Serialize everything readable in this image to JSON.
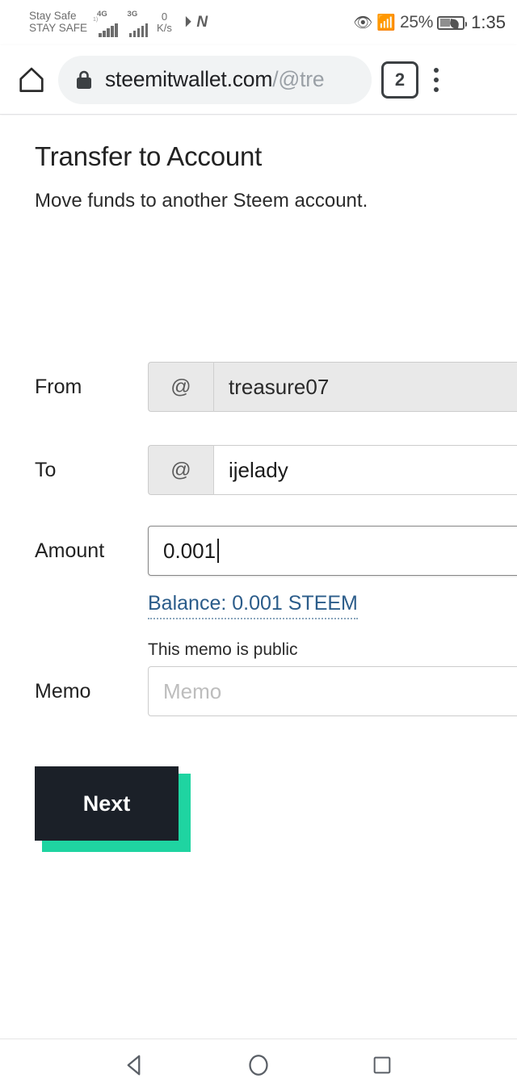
{
  "statusbar": {
    "carrier_line1": "Stay Safe",
    "carrier_line2": "STAY SAFE",
    "signal1_label": "4G",
    "signal1_sub": "1)",
    "signal2_label": "3G",
    "netspeed_value": "0",
    "netspeed_unit": "K/s",
    "app_icon_1": "telegram-send-icon",
    "app_icon_2": "netflix-n-icon",
    "eye_icon": "eye-comfort-icon",
    "vibrate_icon": "vibrate-icon",
    "battery_percent": "25%",
    "battery_saver_icon": "leaf-power-saving-icon",
    "clock": "1:35"
  },
  "browser": {
    "home_icon": "home-icon",
    "lock_icon": "lock-icon",
    "url_domain": "steemitwallet.com",
    "url_path": "/@tre",
    "tab_count": "2",
    "menu_icon": "kebab-menu-icon"
  },
  "page": {
    "title": "Transfer to Account",
    "subtitle": "Move funds to another Steem account.",
    "fields": [
      {
        "label": "From",
        "addon": "@",
        "value": "treasure07",
        "placeholder": "",
        "disabled": true
      },
      {
        "label": "To",
        "addon": "@",
        "value": "ijelady",
        "placeholder": "",
        "disabled": false
      },
      {
        "label": "Amount",
        "value": "0.001",
        "placeholder": "",
        "focused": true
      },
      {
        "label": "Memo",
        "value": "",
        "placeholder": "Memo"
      }
    ],
    "balance_link": "Balance: 0.001 STEEM",
    "memo_hint": "This memo is public",
    "next_button": "Next"
  },
  "colors": {
    "accent_teal": "#1fd4a1",
    "button_dark": "#1b2028",
    "link_blue": "#2b5c8a",
    "addon_gray": "#e9e9e9"
  },
  "navbar": {
    "back_icon": "back-triangle-icon",
    "home_icon": "home-circle-icon",
    "recents_icon": "recents-square-icon"
  }
}
